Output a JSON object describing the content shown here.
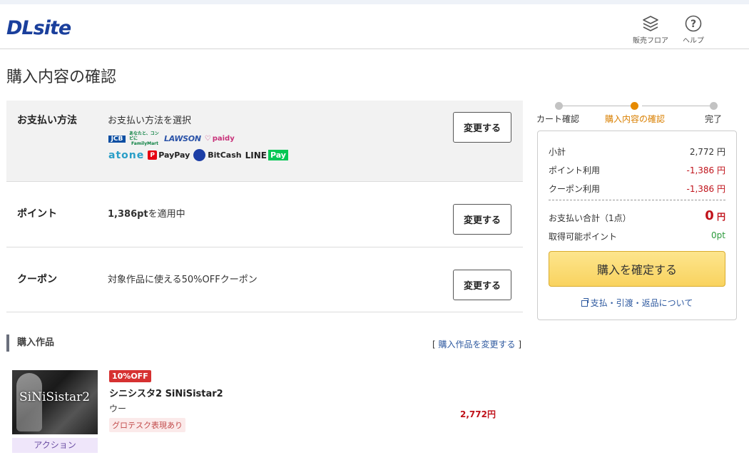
{
  "header": {
    "logo": "DLsite",
    "sales_floor_label": "販売フロア",
    "help_label": "ヘルプ"
  },
  "page_title": "購入内容の確認",
  "payment": {
    "label": "お支払い方法",
    "text": "お支払い方法を選択",
    "change_label": "変更する",
    "logos": {
      "jcb": "JCB",
      "familymart": "FamilyMart",
      "familymart_small": "あなたと、コンビに",
      "lawson": "LAWSON",
      "paidy": "paidy",
      "atone": "atone",
      "paypay": "PayPay",
      "bitcash": "BitCash",
      "line": "LINE",
      "line_pay": "Pay"
    }
  },
  "point": {
    "label": "ポイント",
    "value": "1,386pt",
    "suffix": "を適用中",
    "change_label": "変更する"
  },
  "coupon": {
    "label": "クーポン",
    "text": "対象作品に使える50%OFFクーポン",
    "change_label": "変更する"
  },
  "purchase_items": {
    "heading": "購入作品",
    "change_link_open": "[",
    "change_link": "購入作品を変更する",
    "change_link_close": "]",
    "item": {
      "thumb_title": "SiNiSistar2",
      "genre": "アクション",
      "discount_badge": "10%OFF",
      "title": "シニシスタ2 SiNiSistar2",
      "maker": "ウー",
      "warning_tag": "グロテスク表現あり",
      "price": "2,772円"
    }
  },
  "steps": {
    "items": [
      {
        "label": "カート確認",
        "active": false
      },
      {
        "label": "購入内容の確認",
        "active": true
      },
      {
        "label": "完了",
        "active": false
      }
    ]
  },
  "summary": {
    "subtotal_label": "小計",
    "subtotal_value": "2,772 円",
    "point_use_label": "ポイント利用",
    "point_use_value": "-1,386 円",
    "coupon_use_label": "クーポン利用",
    "coupon_use_value": "-1,386 円",
    "total_label": "お支払い合計（1点）",
    "total_value": "0",
    "total_unit": "円",
    "earned_label": "取得可能ポイント",
    "earned_value": "0pt",
    "confirm_label": "購入を確定する",
    "pay_link": "支払・引渡・返品について"
  },
  "colors": {
    "brand": "#1a3f9c",
    "accent": "#e68a00",
    "price_red": "#c0121a",
    "confirm_yellow": "#f9d35f"
  }
}
